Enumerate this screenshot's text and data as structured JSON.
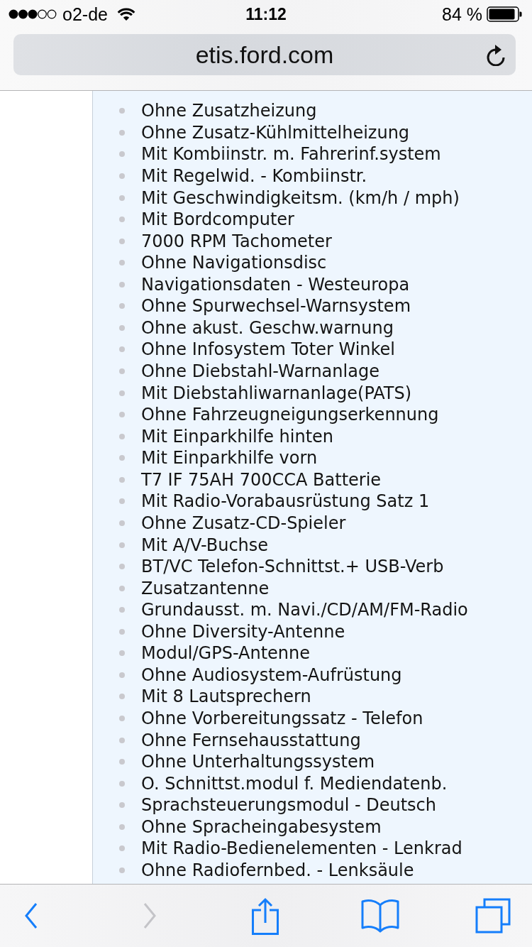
{
  "status_bar": {
    "carrier": "o2-de",
    "time": "11:12",
    "battery": "84 %"
  },
  "address_bar": {
    "url": "etis.ford.com"
  },
  "list": {
    "items": [
      "Ohne Zusatzheizung",
      "Ohne Zusatz-Kühlmittelheizung",
      "Mit Kombiinstr. m. Fahrerinf.system",
      "Mit Regelwid. - Kombiinstr.",
      "Mit Geschwindigkeitsm. (km/h / mph)",
      "Mit Bordcomputer",
      "7000 RPM Tachometer",
      "Ohne Navigationsdisc",
      "Navigationsdaten - Westeuropa",
      "Ohne Spurwechsel-Warnsystem",
      "Ohne akust. Geschw.warnung",
      "Ohne Infosystem Toter Winkel",
      "Ohne Diebstahl-Warnanlage",
      "Mit Diebstahliwarnanlage(PATS)",
      "Ohne Fahrzeugneigungserkennung",
      "Mit Einparkhilfe hinten",
      "Mit Einparkhilfe vorn",
      "T7 IF 75AH 700CCA Batterie",
      "Mit Radio-Vorabausrüstung Satz 1",
      "Ohne Zusatz-CD-Spieler",
      "Mit A/V-Buchse",
      "BT/VC Telefon-Schnittst.+ USB-Verb",
      "Zusatzantenne",
      "Grundausst. m. Navi./CD/AM/FM-Radio",
      "Ohne Diversity-Antenne",
      "Modul/GPS-Antenne",
      "Ohne Audiosystem-Aufrüstung",
      "Mit 8 Lautsprechern",
      "Ohne Vorbereitungssatz - Telefon",
      "Ohne Fernsehausstattung",
      "Ohne Unterhaltungssystem",
      "O. Schnittst.modul f. Mediendatenb.",
      "Sprachsteuerungsmodul - Deutsch",
      "Ohne Spracheingabesystem",
      "Mit Radio-Bedienelementen - Lenkrad",
      "Ohne Radiofernbed. - Lenksäule"
    ]
  },
  "toolbar": {
    "buttons": [
      {
        "kind": "back",
        "disabled": false
      },
      {
        "kind": "forward",
        "disabled": true
      },
      {
        "kind": "share",
        "disabled": false
      },
      {
        "kind": "bookmarks",
        "disabled": false
      },
      {
        "kind": "tabs",
        "disabled": false
      }
    ]
  }
}
